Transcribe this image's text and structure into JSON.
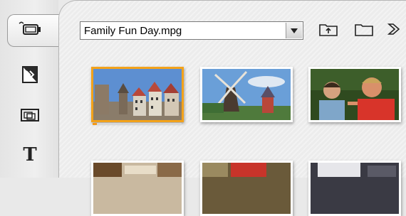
{
  "file_selector": {
    "value": "Family Fun Day.mpg"
  },
  "toolbar": {
    "icons": [
      "folder-up-icon",
      "folder-icon",
      "arrow-icon"
    ]
  },
  "sidebar": {
    "items": [
      {
        "name": "video-clips-icon",
        "active": true
      },
      {
        "name": "transitions-icon",
        "active": false
      },
      {
        "name": "still-images-icon",
        "active": false
      },
      {
        "name": "titles-icon",
        "active": false,
        "glyph": "T"
      }
    ]
  },
  "clips": [
    {
      "name": "clip-town-square",
      "selected": true
    },
    {
      "name": "clip-windmill",
      "selected": false
    },
    {
      "name": "clip-two-people",
      "selected": false
    },
    {
      "name": "clip-row2-1",
      "selected": false
    },
    {
      "name": "clip-row2-2",
      "selected": false
    },
    {
      "name": "clip-row2-3",
      "selected": false
    }
  ],
  "colors": {
    "selection": "#f3a21a",
    "background": "#ececec"
  }
}
